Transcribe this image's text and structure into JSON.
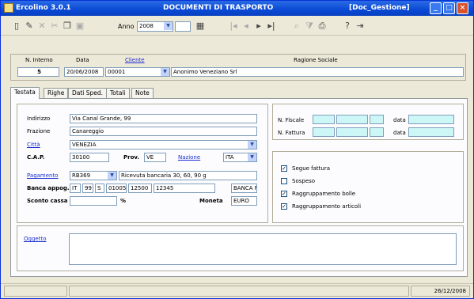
{
  "window": {
    "app_title": "Ercolino 3.0.1",
    "form_title": "DOCUMENTI DI TRASPORTO",
    "module": "[Doc_Gestione]"
  },
  "toolbar": {
    "anno_label": "Anno",
    "anno_value": "2008"
  },
  "header": {
    "n_interno_label": "N. Interno",
    "data_label": "Data",
    "cliente_label": "Cliente",
    "ragione_label": "Ragione Sociale",
    "n_interno": "5",
    "data": "20/06/2008",
    "cliente": "00001",
    "ragione_sociale": "Anonimo Veneziano Srl"
  },
  "tabs": [
    "Testata",
    "Righe",
    "Dati Sped.",
    "Totali",
    "Note"
  ],
  "testata": {
    "indirizzo_label": "Indirizzo",
    "indirizzo": "Via Canal Grande, 99",
    "frazione_label": "Frazione",
    "frazione": "Canareggio",
    "citta_label": "Città",
    "citta": "VENEZIA",
    "cap_label": "C.A.P.",
    "cap": "30100",
    "prov_label": "Prov.",
    "prov": "VE",
    "nazione_label": "Nazione",
    "nazione": "ITA",
    "pagamento_label": "Pagamento",
    "pagamento_code": "RB369",
    "pagamento_desc": "Ricevuta bancaria 30, 60, 90 g",
    "banca_label": "Banca appog.",
    "banca": [
      "IT",
      "99",
      "S",
      "01005",
      "12500",
      "12345",
      "BANCA NA"
    ],
    "sconto_label": "Sconto cassa",
    "sconto_unit": "%",
    "moneta_label": "Moneta",
    "moneta": "EURO",
    "nfiscale_label": "N. Fiscale",
    "nfattura_label": "N. Fattura",
    "data_label": "data",
    "checks": [
      {
        "label": "Segue fattura",
        "checked": true
      },
      {
        "label": "Sospeso",
        "checked": false
      },
      {
        "label": "Raggruppamento bolle",
        "checked": true
      },
      {
        "label": "Raggruppamento articoli",
        "checked": true
      }
    ],
    "oggetto_label": "Oggetto"
  },
  "status": {
    "date": "26/12/2008"
  },
  "colors": {
    "titlebar": "#0a4ad6",
    "link": "#1a2fd0",
    "window_bg": "#ece9d8"
  }
}
